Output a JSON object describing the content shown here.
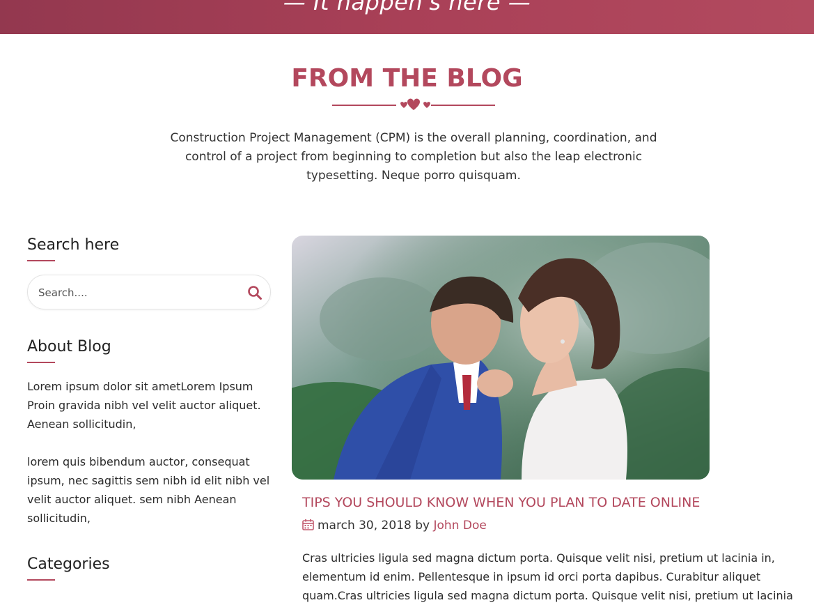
{
  "banner": {
    "tagline": "— It happen's here —"
  },
  "blog_section": {
    "title": "FROM THE BLOG",
    "intro": "Construction Project Management (CPM) is the overall planning, coordination, and control of a project from beginning to completion but also the leap electronic typesetting. Neque porro quisquam."
  },
  "sidebar": {
    "search": {
      "title": "Search here",
      "placeholder": "Search...."
    },
    "about": {
      "title": "About Blog",
      "paragraph_1": "Lorem ipsum dolor sit ametLorem Ipsum Proin gravida nibh vel velit auctor aliquet. Aenean sollicitudin,",
      "paragraph_2": "lorem quis bibendum auctor, consequat ipsum, nec sagittis sem nibh id elit nibh vel velit auctor aliquet. sem nibh Aenean sollicitudin,"
    },
    "categories": {
      "title": "Categories"
    }
  },
  "post": {
    "image_alt": "couple-photo",
    "title": "TIPS YOU SHOULD KNOW WHEN YOU PLAN TO DATE ONLINE",
    "date": "march 30, 2018",
    "by": "by",
    "author": "John Doe",
    "excerpt": "Cras ultricies ligula sed magna dictum porta. Quisque velit nisi, pretium ut lacinia in, elementum id enim. Pellentesque in ipsum id orci porta dapibus. Curabitur aliquet quam.Cras ultricies ligula sed magna dictum porta. Quisque velit nisi, pretium ut lacinia"
  },
  "colors": {
    "accent": "#b3485d",
    "banner_start": "#93384f",
    "banner_end": "#b24a5f"
  },
  "icons": {
    "search": "search-icon",
    "calendar": "calendar-icon",
    "divider": "hearts-divider-icon"
  }
}
